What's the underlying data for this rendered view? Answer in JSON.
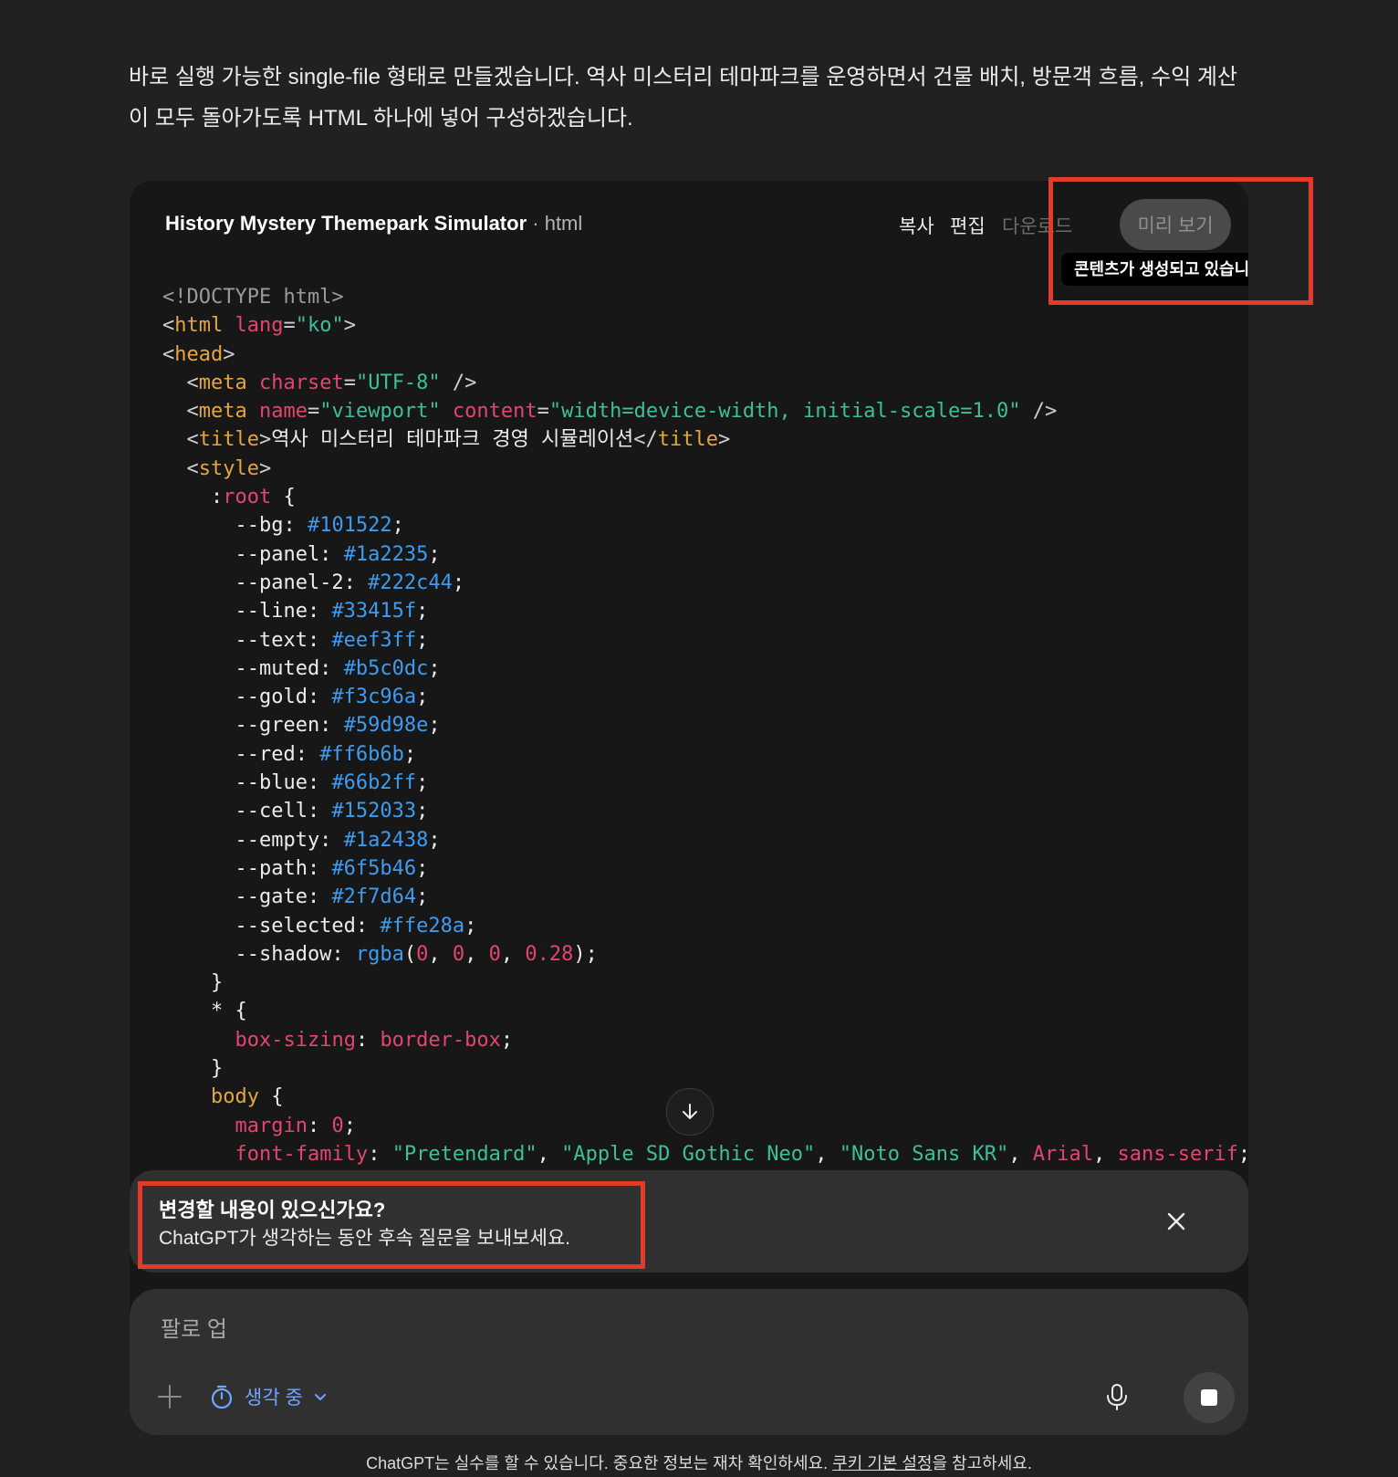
{
  "intro_text": "바로 실행 가능한 single-file 형태로 만들겠습니다. 역사 미스터리 테마파크를 운영하면서 건물 배치, 방문객 흐름, 수익 계산이 모두 돌아가도록 HTML 하나에 넣어 구성하겠습니다.",
  "code_card": {
    "title": "History Mystery Themepark Simulator",
    "separator": " · ",
    "language": "html",
    "buttons": {
      "copy": "복사",
      "edit": "편집",
      "download": "다운로드",
      "preview": "미리 보기"
    },
    "tooltip": "콘텐츠가 생성되고 있습니다...",
    "code_lines": [
      [
        {
          "t": "<!DOCTYPE html>",
          "c": "t-gray"
        }
      ],
      [
        {
          "t": "<",
          "c": "t-punct"
        },
        {
          "t": "html",
          "c": "t-tag"
        },
        {
          "t": " "
        },
        {
          "t": "lang",
          "c": "t-attr"
        },
        {
          "t": "=",
          "c": "t-punct"
        },
        {
          "t": "\"ko\"",
          "c": "t-str"
        },
        {
          "t": ">",
          "c": "t-punct"
        }
      ],
      [
        {
          "t": "<",
          "c": "t-punct"
        },
        {
          "t": "head",
          "c": "t-tag"
        },
        {
          "t": ">",
          "c": "t-punct"
        }
      ],
      [
        {
          "t": "  <",
          "c": "t-punct"
        },
        {
          "t": "meta",
          "c": "t-tag"
        },
        {
          "t": " "
        },
        {
          "t": "charset",
          "c": "t-attr"
        },
        {
          "t": "=",
          "c": "t-punct"
        },
        {
          "t": "\"UTF-8\"",
          "c": "t-str"
        },
        {
          "t": " />",
          "c": "t-punct"
        }
      ],
      [
        {
          "t": "  <",
          "c": "t-punct"
        },
        {
          "t": "meta",
          "c": "t-tag"
        },
        {
          "t": " "
        },
        {
          "t": "name",
          "c": "t-attr"
        },
        {
          "t": "=",
          "c": "t-punct"
        },
        {
          "t": "\"viewport\"",
          "c": "t-str"
        },
        {
          "t": " "
        },
        {
          "t": "content",
          "c": "t-attr"
        },
        {
          "t": "=",
          "c": "t-punct"
        },
        {
          "t": "\"width=device-width, initial-scale=1.0\"",
          "c": "t-str"
        },
        {
          "t": " />",
          "c": "t-punct"
        }
      ],
      [
        {
          "t": "  <",
          "c": "t-punct"
        },
        {
          "t": "title",
          "c": "t-tag"
        },
        {
          "t": ">",
          "c": "t-punct"
        },
        {
          "t": "역사 미스터리 테마파크 경영 시뮬레이션"
        },
        {
          "t": "</",
          "c": "t-punct"
        },
        {
          "t": "title",
          "c": "t-tag"
        },
        {
          "t": ">",
          "c": "t-punct"
        }
      ],
      [
        {
          "t": "  <",
          "c": "t-punct"
        },
        {
          "t": "style",
          "c": "t-tag"
        },
        {
          "t": ">",
          "c": "t-punct"
        }
      ],
      [
        {
          "t": "    :"
        },
        {
          "t": "root",
          "c": "t-pink"
        },
        {
          "t": " {"
        }
      ],
      [
        {
          "t": "      --bg: "
        },
        {
          "t": "#101522",
          "c": "t-num"
        },
        {
          "t": ";"
        }
      ],
      [
        {
          "t": "      --panel: "
        },
        {
          "t": "#1a2235",
          "c": "t-num"
        },
        {
          "t": ";"
        }
      ],
      [
        {
          "t": "      --panel-2: "
        },
        {
          "t": "#222c44",
          "c": "t-num"
        },
        {
          "t": ";"
        }
      ],
      [
        {
          "t": "      --line: "
        },
        {
          "t": "#33415f",
          "c": "t-num"
        },
        {
          "t": ";"
        }
      ],
      [
        {
          "t": "      --text: "
        },
        {
          "t": "#eef3ff",
          "c": "t-num"
        },
        {
          "t": ";"
        }
      ],
      [
        {
          "t": "      --muted: "
        },
        {
          "t": "#b5c0dc",
          "c": "t-num"
        },
        {
          "t": ";"
        }
      ],
      [
        {
          "t": "      --gold: "
        },
        {
          "t": "#f3c96a",
          "c": "t-num"
        },
        {
          "t": ";"
        }
      ],
      [
        {
          "t": "      --green: "
        },
        {
          "t": "#59d98e",
          "c": "t-num"
        },
        {
          "t": ";"
        }
      ],
      [
        {
          "t": "      --red: "
        },
        {
          "t": "#ff6b6b",
          "c": "t-num"
        },
        {
          "t": ";"
        }
      ],
      [
        {
          "t": "      --blue: "
        },
        {
          "t": "#66b2ff",
          "c": "t-num"
        },
        {
          "t": ";"
        }
      ],
      [
        {
          "t": "      --cell: "
        },
        {
          "t": "#152033",
          "c": "t-num"
        },
        {
          "t": ";"
        }
      ],
      [
        {
          "t": "      --empty: "
        },
        {
          "t": "#1a2438",
          "c": "t-num"
        },
        {
          "t": ";"
        }
      ],
      [
        {
          "t": "      --path: "
        },
        {
          "t": "#6f5b46",
          "c": "t-num"
        },
        {
          "t": ";"
        }
      ],
      [
        {
          "t": "      --gate: "
        },
        {
          "t": "#2f7d64",
          "c": "t-num"
        },
        {
          "t": ";"
        }
      ],
      [
        {
          "t": "      --selected: "
        },
        {
          "t": "#ffe28a",
          "c": "t-num"
        },
        {
          "t": ";"
        }
      ],
      [
        {
          "t": "      --shadow: "
        },
        {
          "t": "rgba",
          "c": "t-num"
        },
        {
          "t": "("
        },
        {
          "t": "0",
          "c": "t-pink"
        },
        {
          "t": ", "
        },
        {
          "t": "0",
          "c": "t-pink"
        },
        {
          "t": ", "
        },
        {
          "t": "0",
          "c": "t-pink"
        },
        {
          "t": ", "
        },
        {
          "t": "0.28",
          "c": "t-pink"
        },
        {
          "t": ");"
        }
      ],
      [
        {
          "t": "    }"
        }
      ],
      [
        {
          "t": "    * {"
        }
      ],
      [
        {
          "t": "      "
        },
        {
          "t": "box-sizing",
          "c": "t-pink"
        },
        {
          "t": ": "
        },
        {
          "t": "border-box",
          "c": "t-pink"
        },
        {
          "t": ";"
        }
      ],
      [
        {
          "t": "    }"
        }
      ],
      [
        {
          "t": "    "
        },
        {
          "t": "body",
          "c": "t-tag"
        },
        {
          "t": " {"
        }
      ],
      [
        {
          "t": "      "
        },
        {
          "t": "margin",
          "c": "t-pink"
        },
        {
          "t": ": "
        },
        {
          "t": "0",
          "c": "t-pink"
        },
        {
          "t": ";"
        }
      ],
      [
        {
          "t": "      "
        },
        {
          "t": "font-family",
          "c": "t-pink"
        },
        {
          "t": ": "
        },
        {
          "t": "\"Pretendard\"",
          "c": "t-str"
        },
        {
          "t": ", "
        },
        {
          "t": "\"Apple SD Gothic Neo\"",
          "c": "t-str"
        },
        {
          "t": ", "
        },
        {
          "t": "\"Noto Sans KR\"",
          "c": "t-str"
        },
        {
          "t": ", "
        },
        {
          "t": "Arial",
          "c": "t-pink"
        },
        {
          "t": ", "
        },
        {
          "t": "sans-serif",
          "c": "t-pink"
        },
        {
          "t": ";"
        }
      ]
    ]
  },
  "banner": {
    "title": "변경할 내용이 있으신가요?",
    "subtitle": "ChatGPT가 생각하는 동안 후속 질문을 보내보세요."
  },
  "composer": {
    "placeholder": "팔로 업",
    "thinking_label": "생각 중"
  },
  "footer": {
    "text_before": "ChatGPT는 실수를 할 수 있습니다. 중요한 정보는 재차 확인하세요. ",
    "link": "쿠키 기본 설정",
    "text_after": "을 참고하세요."
  },
  "colors": {
    "background": "#212121",
    "code_card": "#171717",
    "highlight": "#e33b2a",
    "accent_blue": "#6ea7ff"
  },
  "icons": [
    "arrow-down-icon",
    "close-icon",
    "plus-icon",
    "timer-icon",
    "chevron-down-icon",
    "microphone-icon",
    "stop-icon"
  ]
}
